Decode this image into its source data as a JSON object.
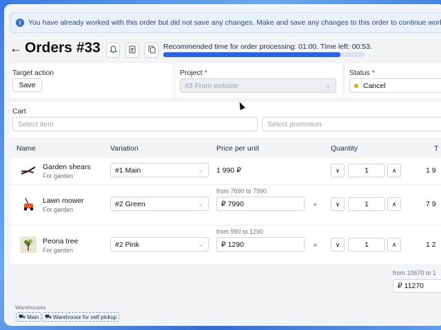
{
  "banner": {
    "icon": "info-icon",
    "text": "You have already worked with this order but did not save any changes. Make and save any changes to this order to continue working wi"
  },
  "header": {
    "back_icon": "arrow-left-icon",
    "title": "Orders #33",
    "buttons": [
      "bell-icon",
      "document-icon",
      "copy-icon"
    ],
    "timer_text": "Recommended time for order processing: 01:00. Time left: 00:53.",
    "timer_progress": 0.88
  },
  "target_action": {
    "label": "Target action",
    "button": "Save"
  },
  "project": {
    "label": "Project",
    "required": "*",
    "value": "#3 From website"
  },
  "status": {
    "label": "Status",
    "required": "*",
    "value": "Cancel",
    "dot_color": "#f59e0b"
  },
  "cart": {
    "label": "Cart",
    "select_item_placeholder": "Select item",
    "select_promotion_placeholder": "Select promotion"
  },
  "table": {
    "headers": [
      "Name",
      "Variation",
      "Price per unit",
      "Quantity",
      "T"
    ],
    "rows": [
      {
        "name": "Garden shears",
        "category": "For garden",
        "thumb": "shears-icon",
        "variation": "#1 Main",
        "price_range": "",
        "price": "1 990 ₽",
        "quantity": "1",
        "total": "1 9"
      },
      {
        "name": "Lawn mower",
        "category": "For garden",
        "thumb": "lawn-mower-icon",
        "variation": "#2 Green",
        "price_range": "from 7690 to 7990",
        "price": "₽ 7990",
        "quantity": "1",
        "total": "7 9"
      },
      {
        "name": "Peona tree",
        "category": "For garden",
        "thumb": "plant-icon",
        "variation": "#2 Pink",
        "price_range": "from 990 to 1290",
        "price": "₽ 1290",
        "quantity": "1",
        "total": "1 2"
      }
    ],
    "summary_range": "from 10670 to 1",
    "summary_price": "₽ 11270"
  },
  "warehouses": {
    "label": "Warehouses",
    "items": [
      "Main",
      "Warehouse for self pickup"
    ]
  }
}
